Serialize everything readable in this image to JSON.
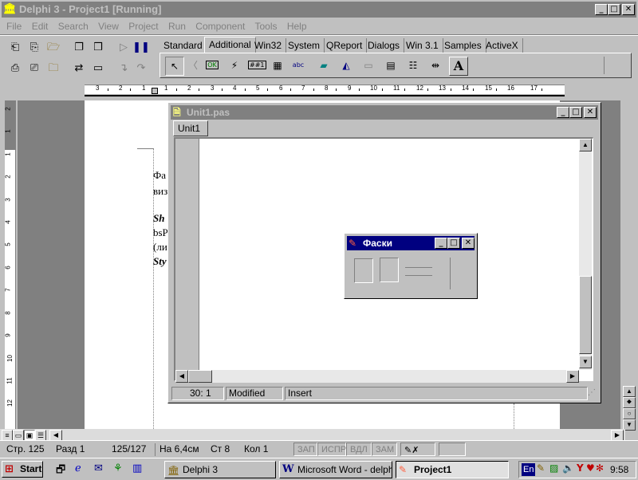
{
  "delphi": {
    "title": "Delphi 3 - Project1 [Running]",
    "menu": [
      "File",
      "Edit",
      "Search",
      "View",
      "Project",
      "Run",
      "Component",
      "Tools",
      "Help"
    ],
    "palette_tabs": [
      "Standard",
      "Additional",
      "Win32",
      "System",
      "QReport",
      "Dialogs",
      "Win 3.1",
      "Samples",
      "ActiveX"
    ],
    "active_tab": "Additional",
    "palette_icon_ok": "OK",
    "palette_icon_abc": "abc",
    "palette_icon_a": "A",
    "palette_icon_bmp": "##1"
  },
  "word": {
    "doc_text": [
      "Фа",
      "виз",
      "Sh",
      "bsP",
      "(ли",
      "Sty"
    ],
    "ruler_numbers": [
      "3",
      "2",
      "1",
      "1",
      "2",
      "3",
      "4",
      "5",
      "6",
      "7",
      "8",
      "9",
      "10",
      "11",
      "12",
      "13",
      "14",
      "15",
      "16",
      "17"
    ],
    "v_ruler_numbers": [
      "2",
      "1",
      "1",
      "2",
      "3",
      "4",
      "5",
      "6",
      "7",
      "8",
      "9",
      "10",
      "11",
      "12"
    ],
    "status": {
      "page": "Стр. 125",
      "section": "Разд 1",
      "pages": "125/127",
      "at": "На 6,4см",
      "line": "Ст 8",
      "col": "Кол 1",
      "rec": "ЗАП",
      "trk": "ИСПР",
      "ext": "ВДЛ",
      "ovr": "ЗАМ"
    }
  },
  "editor": {
    "title": "Unit1.pas",
    "tab": "Unit1",
    "position": "30:  1",
    "modified": "Modified",
    "mode": "Insert"
  },
  "form": {
    "title": "Фаски"
  },
  "taskbar": {
    "start": "Start",
    "tasks": [
      "Delphi 3",
      "Microsoft Word - delphi",
      "Project1"
    ],
    "active_task": "Project1",
    "lang": "En",
    "clock": "9:58"
  },
  "colors": {
    "active_title": "#000080",
    "inactive_title": "#808080",
    "face": "#c0c0c0"
  }
}
